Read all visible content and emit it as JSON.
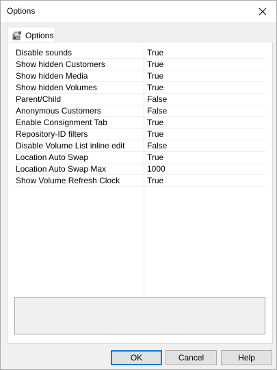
{
  "window": {
    "title": "Options"
  },
  "icons": {
    "close": "close-icon",
    "tab": "options-page-icon"
  },
  "tabs": [
    {
      "label": "Options",
      "selected": true
    }
  ],
  "properties": [
    {
      "name": "Disable sounds",
      "value": "True"
    },
    {
      "name": "Show hidden Customers",
      "value": "True"
    },
    {
      "name": "Show hidden Media",
      "value": "True"
    },
    {
      "name": "Show hidden Volumes",
      "value": "True"
    },
    {
      "name": "Parent/Child",
      "value": "False"
    },
    {
      "name": "Anonymous Customers",
      "value": "False"
    },
    {
      "name": "Enable Consignment Tab",
      "value": "True"
    },
    {
      "name": "Repository-ID filters",
      "value": "True"
    },
    {
      "name": "Disable Volume List inline edit",
      "value": "False"
    },
    {
      "name": "Location Auto Swap",
      "value": "True"
    },
    {
      "name": "Location Auto Swap Max",
      "value": "1000"
    },
    {
      "name": "Show Volume Refresh Clock",
      "value": "True"
    }
  ],
  "description": "",
  "buttons": {
    "ok": "OK",
    "cancel": "Cancel",
    "help": "Help"
  },
  "colors": {
    "accent": "#0078d7",
    "panel": "#f0f0f0",
    "button": "#e1e1e1"
  }
}
